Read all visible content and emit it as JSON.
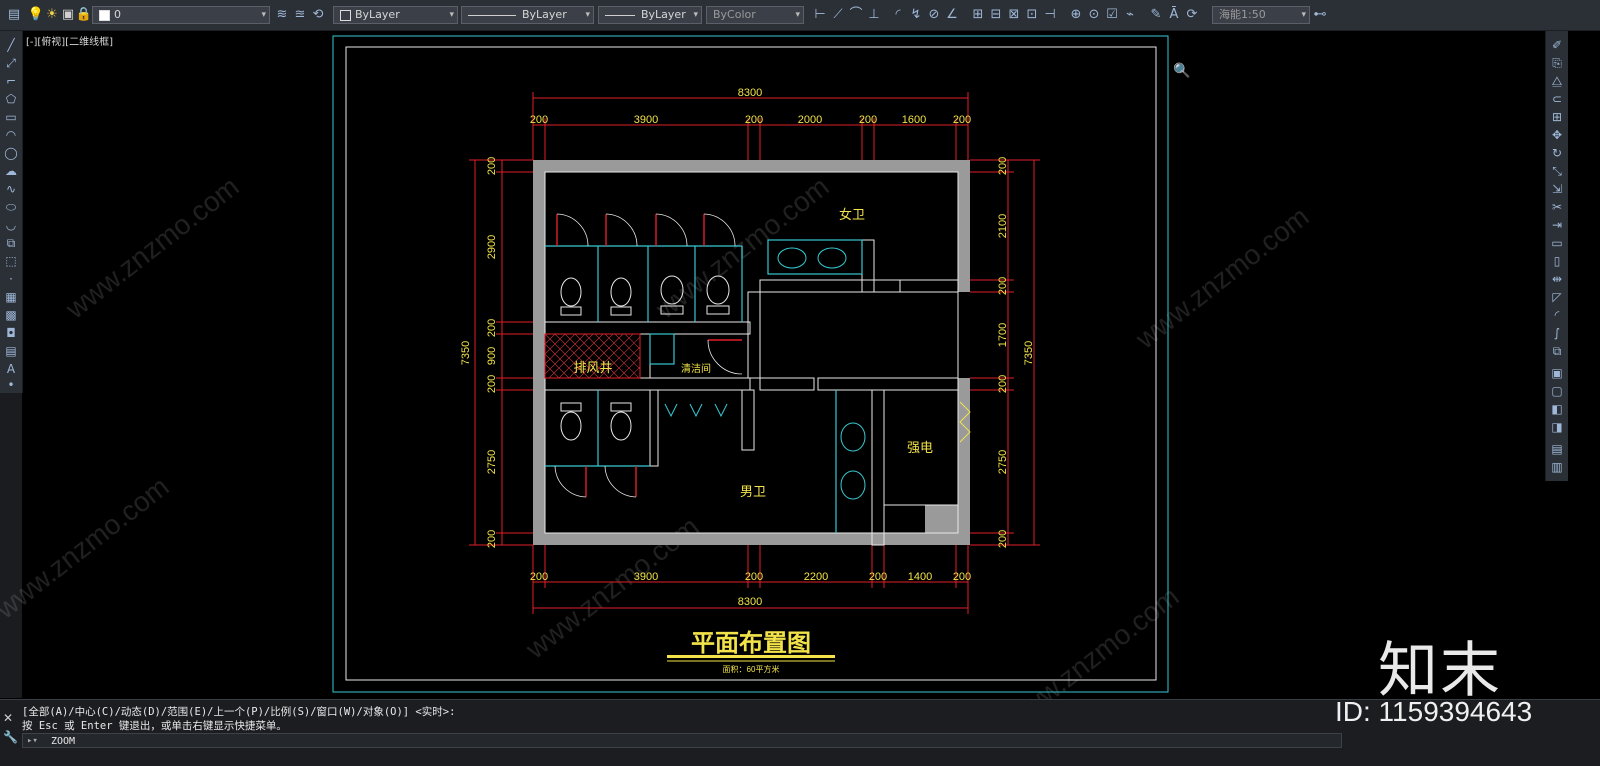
{
  "toolbar": {
    "layer_name": "0",
    "color_label": "ByLayer",
    "linetype_label": "ByLayer",
    "lineweight_label": "ByLayer",
    "plotstyle_label": "ByColor",
    "scale_label": "海能1:50"
  },
  "viewport": {
    "view_label": "[-][俯视][二维线框]"
  },
  "drawing": {
    "dims_top_total": "8300",
    "dims_top": [
      "200",
      "3900",
      "200",
      "2000",
      "200",
      "1600",
      "200"
    ],
    "dims_bottom": [
      "200",
      "3900",
      "200",
      "2200",
      "200",
      "1400",
      "200"
    ],
    "dims_bottom_total": "8300",
    "dims_left": [
      "200",
      "2900",
      "200",
      "900",
      "200",
      "2750",
      "200"
    ],
    "dims_left_total": "7350",
    "dims_right": [
      "200",
      "2100",
      "200",
      "1700",
      "200",
      "2750",
      "200"
    ],
    "dims_right_total": "7350",
    "room_women": "女卫",
    "room_men": "男卫",
    "room_shaft": "排风井",
    "room_cleaning": "清洁间",
    "room_electric": "强电",
    "title": "平面布置图",
    "subtitle": "面积：60平方米"
  },
  "command": {
    "options_line": "[全部(A)/中心(C)/动态(D)/范围(E)/上一个(P)/比例(S)/窗口(W)/对象(O)] <实时>:",
    "hint_line": "按 Esc 或 Enter 键退出，或单击右键显示快捷菜单。",
    "input_value": "ZOOM"
  },
  "branding": {
    "logo_text": "知末",
    "id_text": "ID: 1159394643",
    "watermark": "www.znzmo.com"
  },
  "colors": {
    "accent_yellow": "#f2e34a",
    "dim_red": "#e0202a",
    "wall_gray": "#9a9a9a",
    "cyan": "#36c9d2"
  }
}
